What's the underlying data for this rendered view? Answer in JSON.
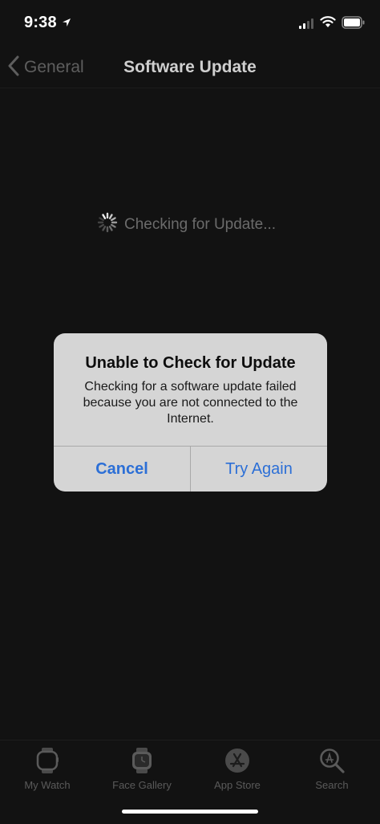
{
  "status_bar": {
    "time": "9:38",
    "icons": [
      "location-arrow-icon",
      "signal-icon",
      "wifi-icon",
      "battery-icon"
    ]
  },
  "nav": {
    "back_label": "General",
    "title": "Software Update"
  },
  "content": {
    "checking_text": "Checking for Update..."
  },
  "alert": {
    "title": "Unable to Check for Update",
    "message_lines": [
      "Checking for a software update failed",
      "because you are not connected to the",
      "Internet."
    ],
    "cancel_label": "Cancel",
    "retry_label": "Try Again",
    "button_color": "#2c6fd6"
  },
  "tab_bar": {
    "items": [
      {
        "label": "My Watch",
        "icon": "watch-icon"
      },
      {
        "label": "Face Gallery",
        "icon": "face-gallery-icon"
      },
      {
        "label": "App Store",
        "icon": "app-store-icon"
      },
      {
        "label": "Search",
        "icon": "search-icon"
      }
    ]
  }
}
